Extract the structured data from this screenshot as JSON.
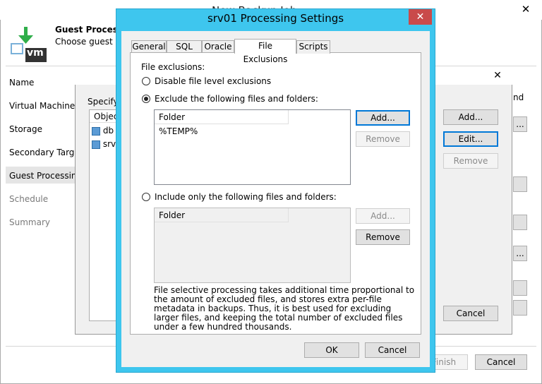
{
  "background_window": {
    "title": "New Backup Job",
    "close_glyph": "✕",
    "header_title": "Guest Processing",
    "header_subtitle": "Choose guest OS processing options available for running VMs.",
    "logo_text": "vm",
    "nav": [
      "Name",
      "Virtual Machines",
      "Storage",
      "Secondary Target",
      "Guest Processing",
      "Schedule",
      "Summary"
    ],
    "finish_label": "Finish",
    "cancel_label": "Cancel"
  },
  "middle_dialog": {
    "close_glyph": "✕",
    "specify_text": "Specify",
    "list_header": "Object",
    "rows": [
      "db",
      "srv"
    ],
    "right_text": "nd",
    "add_label": "Add...",
    "edit_label": "Edit...",
    "remove_label": "Remove",
    "cancel_label": "Cancel",
    "ellipsis": "..."
  },
  "dialog": {
    "title": "srv01 Processing Settings",
    "close_glyph": "✕",
    "tabs": [
      "General",
      "SQL",
      "Oracle",
      "File Exclusions",
      "Scripts"
    ],
    "section_label": "File exclusions:",
    "options": {
      "disable": "Disable file level exclusions",
      "exclude": "Exclude the following files and folders:",
      "include": "Include only the following files and folders:"
    },
    "exclude_list": {
      "header": "Folder",
      "items": [
        "%TEMP%"
      ],
      "add_label": "Add...",
      "remove_label": "Remove"
    },
    "include_list": {
      "header": "Folder",
      "add_label": "Add...",
      "remove_label": "Remove"
    },
    "note": "File selective processing takes additional time proportional to the amount of excluded files, and stores extra per-file metadata in backups. Thus, it is best used for excluding larger files, and keeping the total number of excluded files under a few hundred thousands.",
    "ok_label": "OK",
    "cancel_label": "Cancel"
  },
  "colors": {
    "title_bar": "#3ec6ee",
    "close_button": "#c94a4a",
    "logo_green": "#2fae4a",
    "logo_dark": "#333333",
    "focus_blue": "#0078d7"
  }
}
